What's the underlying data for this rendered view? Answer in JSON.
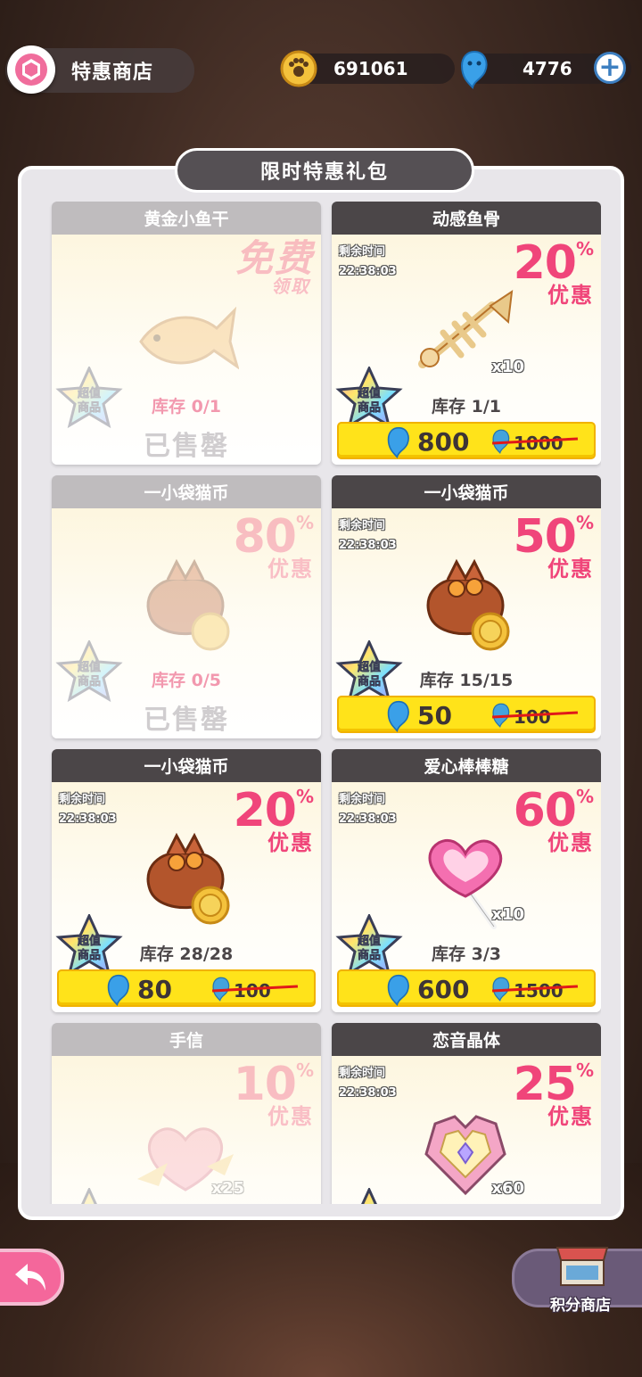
{
  "header": {
    "title": "特惠商店",
    "coins": "691061",
    "gems": "4776"
  },
  "panel": {
    "title": "限时特惠礼包"
  },
  "labels": {
    "timer": "剩余时间",
    "discount_word": "优惠",
    "badge_top": "超值",
    "badge_bottom": "商品",
    "sold_out": "已售罄",
    "free_big": "免费",
    "free_small": "领取"
  },
  "items": [
    {
      "name": "黄金小鱼干",
      "sold": true,
      "free": true,
      "stock": "库存 0/1",
      "qty": ""
    },
    {
      "name": "动感鱼骨",
      "sold": false,
      "timer": "22:38:03",
      "discount": "20",
      "qty": "x10",
      "stock": "库存 1/1",
      "price": "800",
      "old_price": "1000"
    },
    {
      "name": "一小袋猫币",
      "sold": true,
      "discount": "80",
      "stock": "库存 0/5",
      "qty": ""
    },
    {
      "name": "一小袋猫币",
      "sold": false,
      "timer": "22:38:03",
      "discount": "50",
      "qty": "",
      "stock": "库存 15/15",
      "price": "50",
      "old_price": "100"
    },
    {
      "name": "一小袋猫币",
      "sold": false,
      "timer": "22:38:03",
      "discount": "20",
      "qty": "",
      "stock": "库存 28/28",
      "price": "80",
      "old_price": "100"
    },
    {
      "name": "爱心棒棒糖",
      "sold": false,
      "timer": "22:38:03",
      "discount": "60",
      "qty": "x10",
      "stock": "库存 3/3",
      "price": "600",
      "old_price": "1500"
    },
    {
      "name": "手信",
      "sold": true,
      "discount": "10",
      "qty": "x25",
      "stock": ""
    },
    {
      "name": "恋音晶体",
      "sold": false,
      "timer": "22:38:03",
      "discount": "25",
      "qty": "x60",
      "stock": ""
    }
  ],
  "footer": {
    "points_shop": "积分商店"
  },
  "colors": {
    "accent_pink": "#f0457a",
    "price_yellow": "#ffe31a",
    "card_header": "#4b4648"
  }
}
